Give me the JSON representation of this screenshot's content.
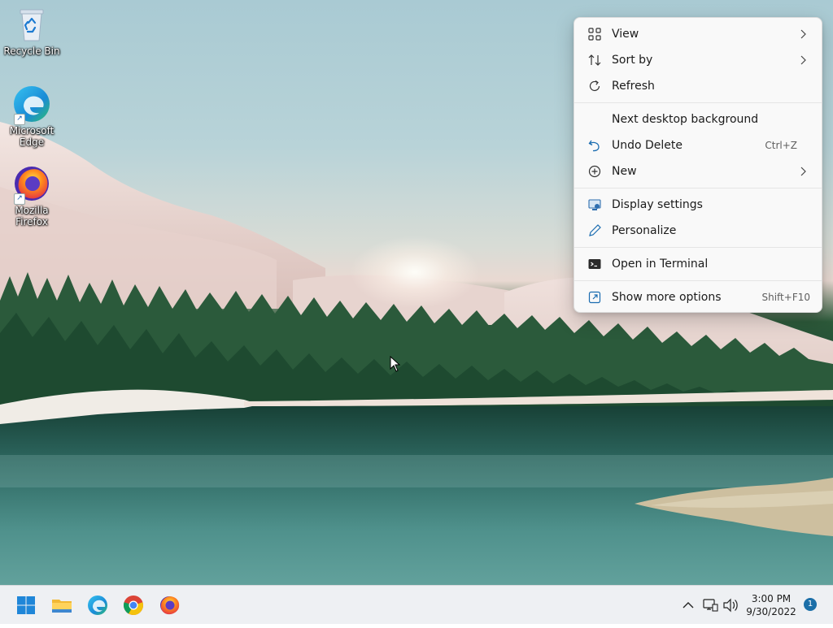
{
  "desktop": {
    "icons": [
      {
        "label": "Recycle Bin"
      },
      {
        "label": "Microsoft Edge"
      },
      {
        "label": "Mozilla Firefox"
      }
    ]
  },
  "context_menu": {
    "items": {
      "view": {
        "label": "View",
        "icon": "grid-icon"
      },
      "sort_by": {
        "label": "Sort by",
        "icon": "sort-icon"
      },
      "refresh": {
        "label": "Refresh",
        "icon": "refresh-icon"
      },
      "next_background": {
        "label": "Next desktop background"
      },
      "undo_delete": {
        "label": "Undo Delete",
        "shortcut": "Ctrl+Z",
        "icon": "undo-icon"
      },
      "new": {
        "label": "New",
        "icon": "plus-circle-icon"
      },
      "display_settings": {
        "label": "Display settings",
        "icon": "display-icon"
      },
      "personalize": {
        "label": "Personalize",
        "icon": "pen-icon"
      },
      "open_terminal": {
        "label": "Open in Terminal",
        "icon": "terminal-icon"
      },
      "show_more": {
        "label": "Show more options",
        "shortcut": "Shift+F10",
        "icon": "external-icon"
      }
    }
  },
  "taskbar": {
    "apps": [
      "start-icon",
      "file-explorer-icon",
      "edge-icon",
      "chrome-icon",
      "firefox-icon"
    ],
    "tray": {
      "time": "3:00 PM",
      "date": "9/30/2022",
      "notification_count": "1"
    }
  },
  "colors": {
    "accent": "#0078d4",
    "menu_bg": "#f9f9f9",
    "taskbar_bg": "#eef0f3"
  }
}
